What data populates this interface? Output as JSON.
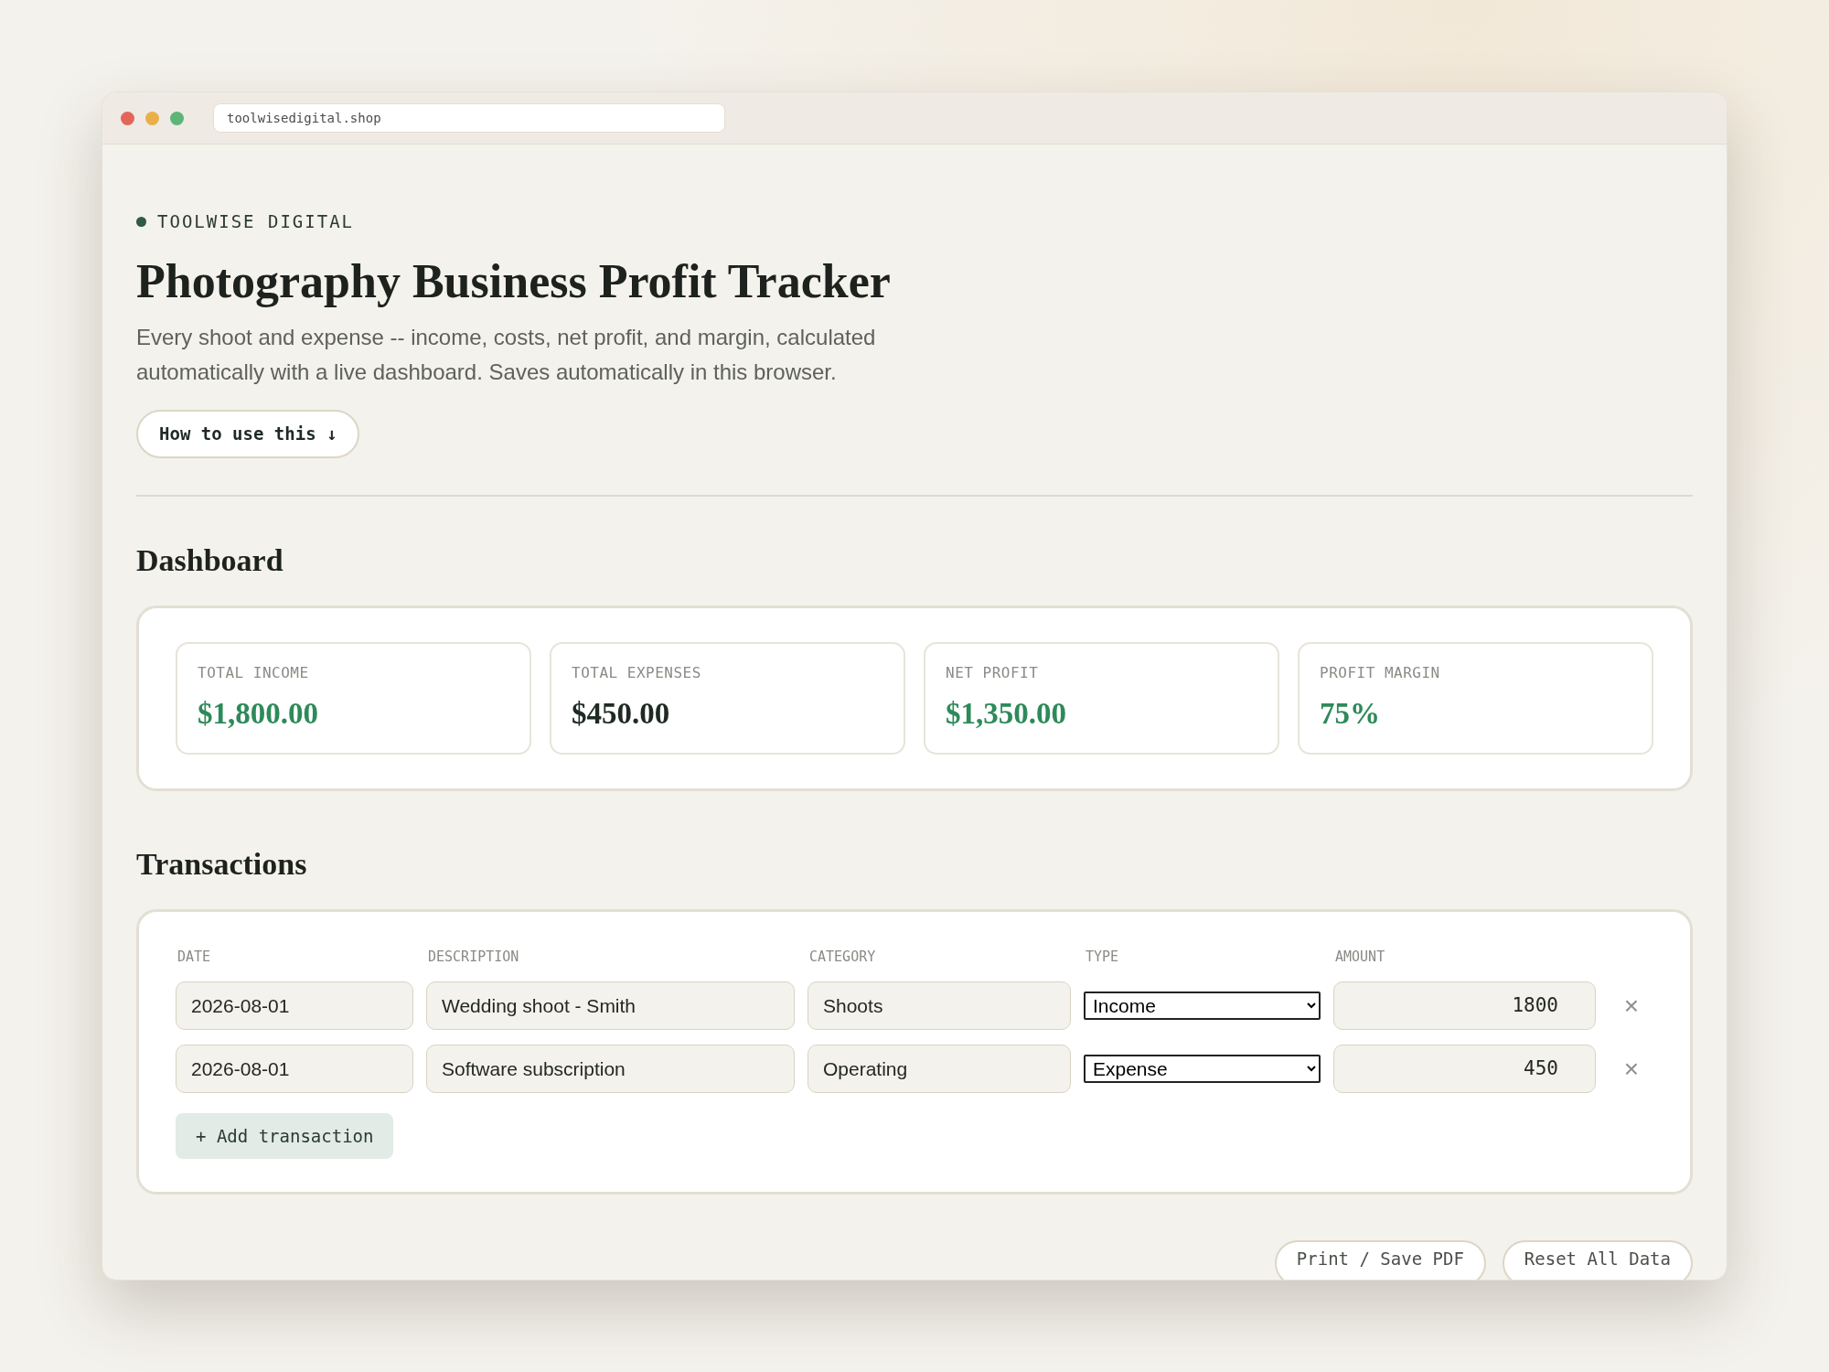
{
  "browser": {
    "url": "toolwisedigital.shop"
  },
  "brand": "TOOLWISE DIGITAL",
  "title": "Photography Business Profit Tracker",
  "intro": "Every shoot and expense -- income, costs, net profit, and margin, calculated automatically with a live dashboard. Saves automatically in this browser.",
  "help_button": "How to use this ↓",
  "dashboard": {
    "heading": "Dashboard",
    "cards": [
      {
        "label": "TOTAL INCOME",
        "value": "$1,800.00",
        "color": "#2e8a5a"
      },
      {
        "label": "TOTAL EXPENSES",
        "value": "$450.00",
        "color": "#1f2a24"
      },
      {
        "label": "NET PROFIT",
        "value": "$1,350.00",
        "color": "#2e8a5a"
      },
      {
        "label": "PROFIT MARGIN",
        "value": "75%",
        "color": "#2e8a5a"
      }
    ]
  },
  "transactions": {
    "heading": "Transactions",
    "columns": [
      "DATE",
      "DESCRIPTION",
      "CATEGORY",
      "TYPE",
      "AMOUNT"
    ],
    "rows": [
      {
        "date": "2026-08-01",
        "description": "Wedding shoot - Smith",
        "category": "Shoots",
        "type": "Income",
        "amount": "1800",
        "remove": "×"
      },
      {
        "date": "2026-08-01",
        "description": "Software subscription",
        "category": "Operating",
        "type": "Expense",
        "amount": "450",
        "remove": "×"
      }
    ],
    "add_button": "+ Add transaction"
  },
  "footer_buttons": [
    "Print / Save PDF",
    "Reset All Data"
  ]
}
